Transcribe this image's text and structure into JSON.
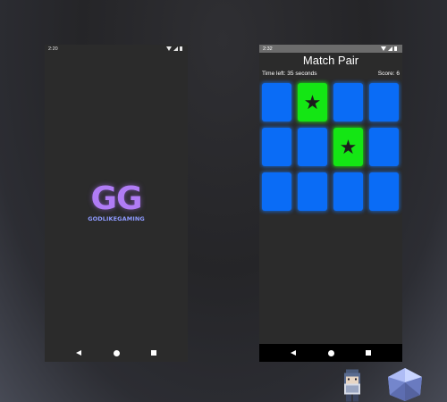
{
  "left_phone": {
    "status_time": "2:20",
    "logo": {
      "mark": "GG",
      "name": "GODLIKEGAMING"
    }
  },
  "right_phone": {
    "status_time": "2:32",
    "title": "Match Pair",
    "time_left": "Time left: 35 seconds",
    "score": "Score: 6",
    "cards": [
      {
        "state": "hidden"
      },
      {
        "state": "revealed",
        "symbol": "★"
      },
      {
        "state": "hidden"
      },
      {
        "state": "hidden"
      },
      {
        "state": "hidden"
      },
      {
        "state": "hidden"
      },
      {
        "state": "revealed",
        "symbol": "★"
      },
      {
        "state": "hidden"
      },
      {
        "state": "hidden"
      },
      {
        "state": "hidden"
      },
      {
        "state": "hidden"
      },
      {
        "state": "hidden"
      }
    ]
  },
  "colors": {
    "card_hidden": "#0a6cf6",
    "card_revealed": "#14e614",
    "logo_purple": "#b07cf5",
    "logo_blue": "#8e9aff"
  }
}
